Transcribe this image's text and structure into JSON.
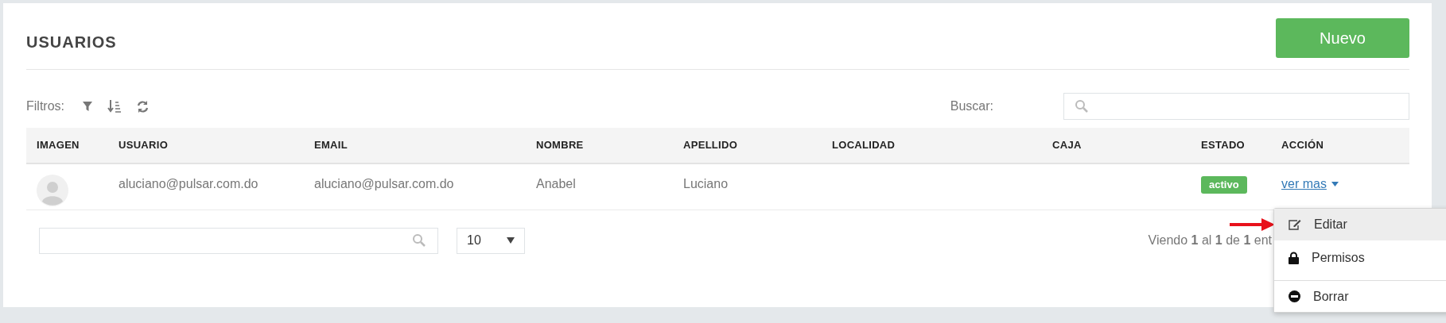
{
  "title": "USUARIOS",
  "new_button": "Nuevo",
  "filters": {
    "label": "Filtros:"
  },
  "search": {
    "label": "Buscar:"
  },
  "table": {
    "columns": [
      "IMAGEN",
      "USUARIO",
      "EMAIL",
      "NOMBRE",
      "APELLIDO",
      "LOCALIDAD",
      "CAJA",
      "ESTADO",
      "ACCIÓN"
    ],
    "rows": [
      {
        "usuario": "aluciano@pulsar.com.do",
        "email": "aluciano@pulsar.com.do",
        "nombre": "Anabel",
        "apellido": "Luciano",
        "estado": {
          "text": "activo",
          "color": "#5cb85c"
        },
        "action": "ver mas"
      }
    ]
  },
  "menu": {
    "expanded": true,
    "items": [
      {
        "kind": "edit",
        "label": "Editar",
        "selected": true
      },
      {
        "kind": "lock",
        "label": "Permisos",
        "selected": false
      },
      {
        "kind": "delete",
        "label": "Borrar",
        "selected": false
      }
    ]
  },
  "page_size": {
    "value": "10"
  },
  "info": "Viendo **1** al **1** de **1** ent"
}
